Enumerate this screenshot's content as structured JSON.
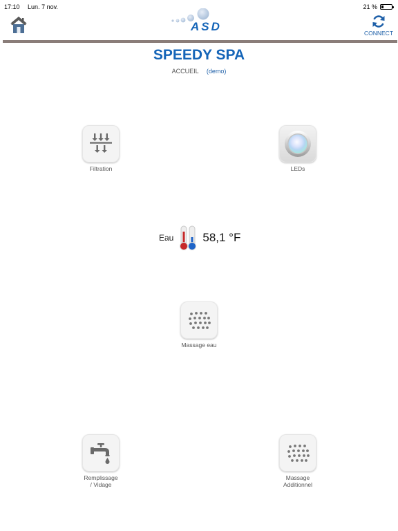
{
  "status_bar": {
    "time": "17:10",
    "date": "Lun. 7 nov.",
    "battery_text": "21 %",
    "battery_level": 0.21
  },
  "header": {
    "logo_text": "ASD",
    "connect_label": "CONNECT",
    "accent_color": "#1565b8"
  },
  "page": {
    "title": "SPEEDY SPA",
    "subtitle": "ACCUEIL",
    "mode": "(demo)"
  },
  "tiles": {
    "filtration": {
      "label": "Filtration",
      "icon": "filtration-arrows-icon"
    },
    "leds": {
      "label": "LEDs",
      "icon": "led-light-icon"
    },
    "massage_eau": {
      "label": "Massage eau",
      "icon": "massage-jets-icon"
    },
    "remplissage": {
      "label_line1": "Remplissage",
      "label_line2": "/ Vidage",
      "icon": "water-tap-icon"
    },
    "massage_add": {
      "label_line1": "Massage",
      "label_line2": "Additionnel",
      "icon": "massage-jets-icon"
    }
  },
  "temperature": {
    "label": "Eau",
    "value": "58,1 °F",
    "icon": "thermometer-icon"
  }
}
